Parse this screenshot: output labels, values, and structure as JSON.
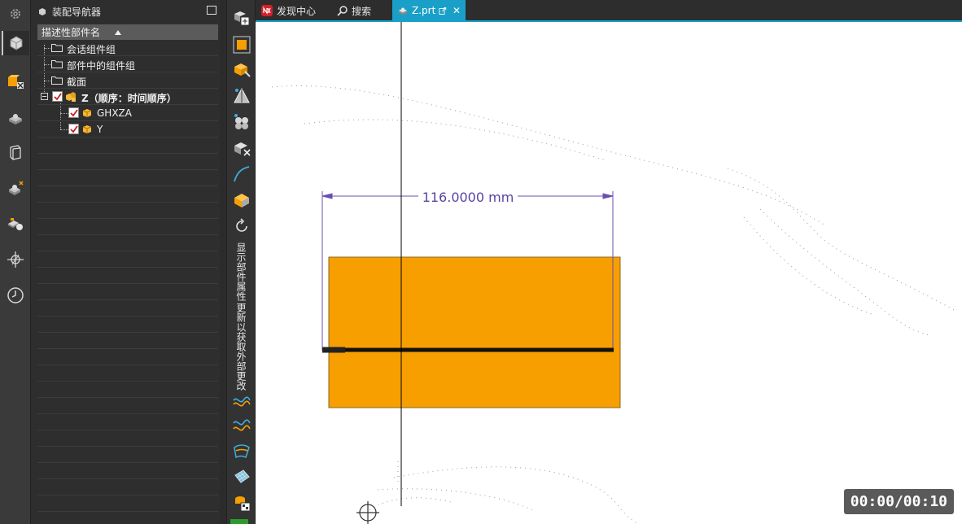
{
  "navigator": {
    "title": "装配导航器",
    "column_header": "描述性部件名",
    "rows": [
      {
        "label": "会话组件组"
      },
      {
        "label": "部件中的组件组"
      },
      {
        "label": "截面"
      },
      {
        "label": "Z（顺序：时间顺序）"
      },
      {
        "label": "GHXZA"
      },
      {
        "label": "Y"
      }
    ]
  },
  "toolbar": {
    "vertical_label_1": "显示部件属性",
    "vertical_label_2": "更新以获取外部更改"
  },
  "tabs": [
    {
      "label": "发现中心",
      "icon": "nx-logo-icon"
    },
    {
      "label": "搜索",
      "icon": "search-icon"
    },
    {
      "label": "Z.prt",
      "icon": "part-file-icon",
      "active": true
    }
  ],
  "graphics": {
    "dimension_text": "116.0000 mm",
    "timer": "00:00/00:10"
  },
  "colors": {
    "accent": "#1aa0c8",
    "part_fill": "#f79f00",
    "dimension": "#6a4fb0",
    "checkbox_mark": "#d11a1a"
  }
}
